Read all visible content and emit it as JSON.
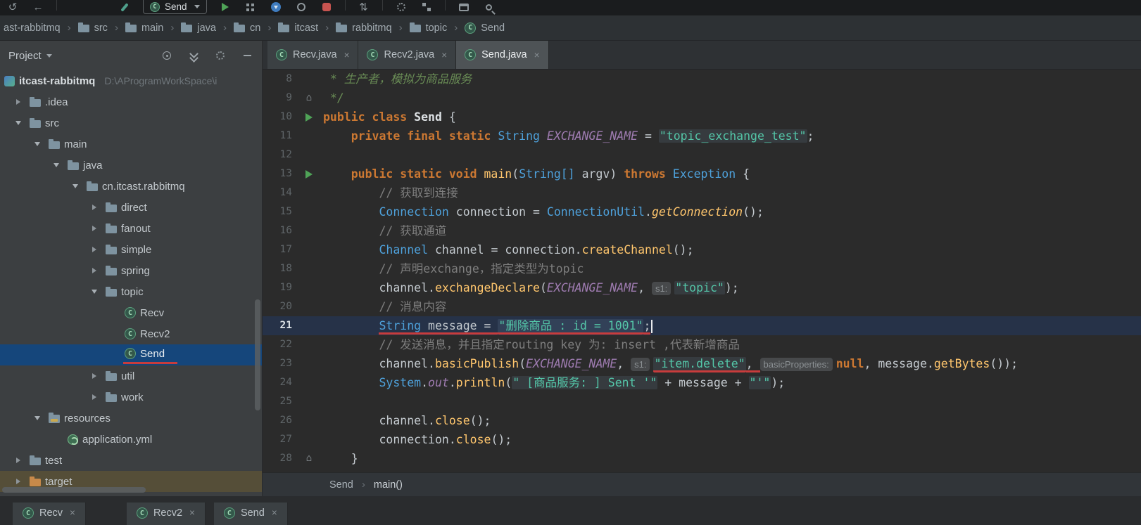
{
  "colors": {
    "run_green": "#4FA357",
    "selection_blue": "#15467B",
    "annotation_red": "#C83C3C",
    "keyword_orange": "#CC7832",
    "type_blue": "#4EA1DB",
    "string_teal": "#54C6A8",
    "method_yellow": "#FFC66D",
    "field_purple": "#9E7BB0",
    "comment_gray": "#7E7E7E",
    "editor_bg": "#2B2B2B",
    "panel_bg": "#3C3F41",
    "excluded_bg": "#554E38"
  },
  "toolbar": {
    "run_config": "Send"
  },
  "breadcrumbs": {
    "items": [
      {
        "label": "ast-rabbitmq",
        "icon": "none"
      },
      {
        "label": "src",
        "icon": "folder"
      },
      {
        "label": "main",
        "icon": "folder"
      },
      {
        "label": "java",
        "icon": "folder"
      },
      {
        "label": "cn",
        "icon": "folder"
      },
      {
        "label": "itcast",
        "icon": "folder"
      },
      {
        "label": "rabbitmq",
        "icon": "folder"
      },
      {
        "label": "topic",
        "icon": "folder"
      },
      {
        "label": "Send",
        "icon": "class"
      }
    ]
  },
  "project": {
    "title": "Project",
    "tree": [
      {
        "label": "itcast-rabbitmq",
        "icon": "project",
        "ind": 0,
        "arrow": "none",
        "root": true,
        "path": "D:\\AProgramWorkSpace\\i"
      },
      {
        "label": ".idea",
        "icon": "folder",
        "ind": 1,
        "arrow": "right"
      },
      {
        "label": "src",
        "icon": "folder",
        "ind": 1,
        "arrow": "down"
      },
      {
        "label": "main",
        "icon": "folder",
        "ind": 2,
        "arrow": "down"
      },
      {
        "label": "java",
        "icon": "folder",
        "ind": 3,
        "arrow": "down"
      },
      {
        "label": "cn.itcast.rabbitmq",
        "icon": "folder",
        "ind": 4,
        "arrow": "down"
      },
      {
        "label": "direct",
        "icon": "folder",
        "ind": 5,
        "arrow": "right"
      },
      {
        "label": "fanout",
        "icon": "folder",
        "ind": 5,
        "arrow": "right"
      },
      {
        "label": "simple",
        "icon": "folder",
        "ind": 5,
        "arrow": "right"
      },
      {
        "label": "spring",
        "icon": "folder",
        "ind": 5,
        "arrow": "right"
      },
      {
        "label": "topic",
        "icon": "folder",
        "ind": 5,
        "arrow": "down"
      },
      {
        "label": "Recv",
        "icon": "class",
        "ind": 6,
        "arrow": "none"
      },
      {
        "label": "Recv2",
        "icon": "class",
        "ind": 6,
        "arrow": "none"
      },
      {
        "label": "Send",
        "icon": "class",
        "ind": 6,
        "arrow": "none",
        "selected": true,
        "underline": true
      },
      {
        "label": "util",
        "icon": "folder",
        "ind": 5,
        "arrow": "right"
      },
      {
        "label": "work",
        "icon": "folder",
        "ind": 5,
        "arrow": "right"
      },
      {
        "label": "resources",
        "icon": "resources",
        "ind": 2,
        "arrow": "down"
      },
      {
        "label": "application.yml",
        "icon": "yml",
        "ind": 3,
        "arrow": "none"
      },
      {
        "label": "test",
        "icon": "folder",
        "ind": 1,
        "arrow": "right"
      },
      {
        "label": "target",
        "icon": "folder-excluded",
        "ind": 1,
        "arrow": "right",
        "row": "excluded"
      }
    ]
  },
  "editor_tabs": {
    "items": [
      {
        "label": "Recv.java",
        "active": false
      },
      {
        "label": "Recv2.java",
        "active": false
      },
      {
        "label": "Send.java",
        "active": true
      }
    ]
  },
  "editor": {
    "lines": [
      {
        "no": 8,
        "tokens": [
          {
            "t": " * 生产者，模拟为商品服务",
            "s": "d"
          }
        ]
      },
      {
        "no": 9,
        "mark": "fold",
        "tokens": [
          {
            "t": " */",
            "s": "d"
          }
        ]
      },
      {
        "no": 10,
        "mark": "run",
        "tokens": [
          {
            "t": "public class ",
            "s": "k"
          },
          {
            "t": "Send ",
            "s": "n"
          },
          {
            "t": "{",
            "s": "p"
          }
        ]
      },
      {
        "no": 11,
        "tokens": [
          {
            "t": "    ",
            "s": "p"
          },
          {
            "t": "private final static ",
            "s": "k"
          },
          {
            "t": "String ",
            "s": "t"
          },
          {
            "t": "EXCHANGE_NAME",
            "s": "f"
          },
          {
            "t": " = ",
            "s": "p"
          },
          {
            "t": "\"topic_exchange_test\"",
            "s": "s"
          },
          {
            "t": ";",
            "s": "p"
          }
        ]
      },
      {
        "no": 12,
        "tokens": []
      },
      {
        "no": 13,
        "mark": "run",
        "tokens": [
          {
            "t": "    ",
            "s": "p"
          },
          {
            "t": "public static void ",
            "s": "k"
          },
          {
            "t": "main",
            "s": "m"
          },
          {
            "t": "(",
            "s": "p"
          },
          {
            "t": "String[] ",
            "s": "t"
          },
          {
            "t": "argv",
            "s": "p"
          },
          {
            "t": ") ",
            "s": "p"
          },
          {
            "t": "throws ",
            "s": "k"
          },
          {
            "t": "Exception ",
            "s": "t"
          },
          {
            "t": "{",
            "s": "p"
          }
        ]
      },
      {
        "no": 14,
        "tokens": [
          {
            "t": "        ",
            "s": "p"
          },
          {
            "t": "// 获取到连接",
            "s": "c"
          }
        ]
      },
      {
        "no": 15,
        "tokens": [
          {
            "t": "        ",
            "s": "p"
          },
          {
            "t": "Connection ",
            "s": "t"
          },
          {
            "t": "connection",
            "s": "p"
          },
          {
            "t": " = ",
            "s": "p"
          },
          {
            "t": "ConnectionUtil",
            "s": "t"
          },
          {
            "t": ".",
            "s": "p"
          },
          {
            "t": "getConnection",
            "s": "mi"
          },
          {
            "t": "();",
            "s": "p"
          }
        ]
      },
      {
        "no": 16,
        "tokens": [
          {
            "t": "        ",
            "s": "p"
          },
          {
            "t": "// 获取通道",
            "s": "c"
          }
        ]
      },
      {
        "no": 17,
        "tokens": [
          {
            "t": "        ",
            "s": "p"
          },
          {
            "t": "Channel ",
            "s": "t"
          },
          {
            "t": "channel",
            "s": "p"
          },
          {
            "t": " = ",
            "s": "p"
          },
          {
            "t": "connection",
            "s": "p"
          },
          {
            "t": ".",
            "s": "p"
          },
          {
            "t": "createChannel",
            "s": "m"
          },
          {
            "t": "();",
            "s": "p"
          }
        ]
      },
      {
        "no": 18,
        "tokens": [
          {
            "t": "        ",
            "s": "p"
          },
          {
            "t": "// 声明exchange，指定类型为topic",
            "s": "c"
          }
        ]
      },
      {
        "no": 19,
        "tokens": [
          {
            "t": "        ",
            "s": "p"
          },
          {
            "t": "channel",
            "s": "p"
          },
          {
            "t": ".",
            "s": "p"
          },
          {
            "t": "exchangeDeclare",
            "s": "m"
          },
          {
            "t": "(",
            "s": "p"
          },
          {
            "t": "EXCHANGE_NAME",
            "s": "f"
          },
          {
            "t": ", ",
            "s": "p"
          },
          {
            "t": "s1:",
            "s": "h"
          },
          {
            "t": "\"topic\"",
            "s": "s"
          },
          {
            "t": ");",
            "s": "p"
          }
        ]
      },
      {
        "no": 20,
        "tokens": [
          {
            "t": "        ",
            "s": "p"
          },
          {
            "t": "// 消息内容",
            "s": "c"
          }
        ]
      },
      {
        "no": 21,
        "current": true,
        "caret": true,
        "tokens": [
          {
            "t": "        ",
            "s": "p"
          },
          {
            "t": "String ",
            "s": "t",
            "u": 1
          },
          {
            "t": "message",
            "s": "p",
            "u": 1
          },
          {
            "t": " = ",
            "s": "p",
            "u": 1
          },
          {
            "t": "\"删除商品 : id = 1001\"",
            "s": "s",
            "u": 1
          },
          {
            "t": ";",
            "s": "p",
            "u": 1
          }
        ]
      },
      {
        "no": 22,
        "tokens": [
          {
            "t": "        ",
            "s": "p"
          },
          {
            "t": "// 发送消息，并且指定routing key 为: insert ,代表新增商品",
            "s": "c"
          }
        ]
      },
      {
        "no": 23,
        "tokens": [
          {
            "t": "        ",
            "s": "p"
          },
          {
            "t": "channel",
            "s": "p"
          },
          {
            "t": ".",
            "s": "p"
          },
          {
            "t": "basicPublish",
            "s": "m"
          },
          {
            "t": "(",
            "s": "p"
          },
          {
            "t": "EXCHANGE_NAME",
            "s": "f"
          },
          {
            "t": ", ",
            "s": "p"
          },
          {
            "t": "s1:",
            "s": "h"
          },
          {
            "t": "\"item.delete\"",
            "s": "s",
            "u": 1
          },
          {
            "t": ", ",
            "s": "p",
            "u": 1
          },
          {
            "t": "basicProperties:",
            "s": "h"
          },
          {
            "t": "null",
            "s": "k"
          },
          {
            "t": ", ",
            "s": "p"
          },
          {
            "t": "message",
            "s": "p"
          },
          {
            "t": ".",
            "s": "p"
          },
          {
            "t": "getBytes",
            "s": "m"
          },
          {
            "t": "());",
            "s": "p"
          }
        ]
      },
      {
        "no": 24,
        "tokens": [
          {
            "t": "        ",
            "s": "p"
          },
          {
            "t": "System",
            "s": "t"
          },
          {
            "t": ".",
            "s": "p"
          },
          {
            "t": "out",
            "s": "f"
          },
          {
            "t": ".",
            "s": "p"
          },
          {
            "t": "println",
            "s": "m"
          },
          {
            "t": "(",
            "s": "p"
          },
          {
            "t": "\" [商品服务: ] Sent '\"",
            "s": "s"
          },
          {
            "t": " + ",
            "s": "p"
          },
          {
            "t": "message",
            "s": "p"
          },
          {
            "t": " + ",
            "s": "p"
          },
          {
            "t": "\"'\"",
            "s": "s"
          },
          {
            "t": ");",
            "s": "p"
          }
        ]
      },
      {
        "no": 25,
        "tokens": []
      },
      {
        "no": 26,
        "tokens": [
          {
            "t": "        ",
            "s": "p"
          },
          {
            "t": "channel",
            "s": "p"
          },
          {
            "t": ".",
            "s": "p"
          },
          {
            "t": "close",
            "s": "m"
          },
          {
            "t": "();",
            "s": "p"
          }
        ]
      },
      {
        "no": 27,
        "tokens": [
          {
            "t": "        ",
            "s": "p"
          },
          {
            "t": "connection",
            "s": "p"
          },
          {
            "t": ".",
            "s": "p"
          },
          {
            "t": "close",
            "s": "m"
          },
          {
            "t": "();",
            "s": "p"
          }
        ]
      },
      {
        "no": 28,
        "mark": "fold",
        "tokens": [
          {
            "t": "    }",
            "s": "p"
          }
        ]
      }
    ]
  },
  "footer": {
    "crumbs": [
      "Send",
      "main()"
    ]
  },
  "bottom_tabs": {
    "items": [
      {
        "label": "Recv"
      },
      {
        "label": "Recv2"
      },
      {
        "label": "Send"
      }
    ]
  }
}
